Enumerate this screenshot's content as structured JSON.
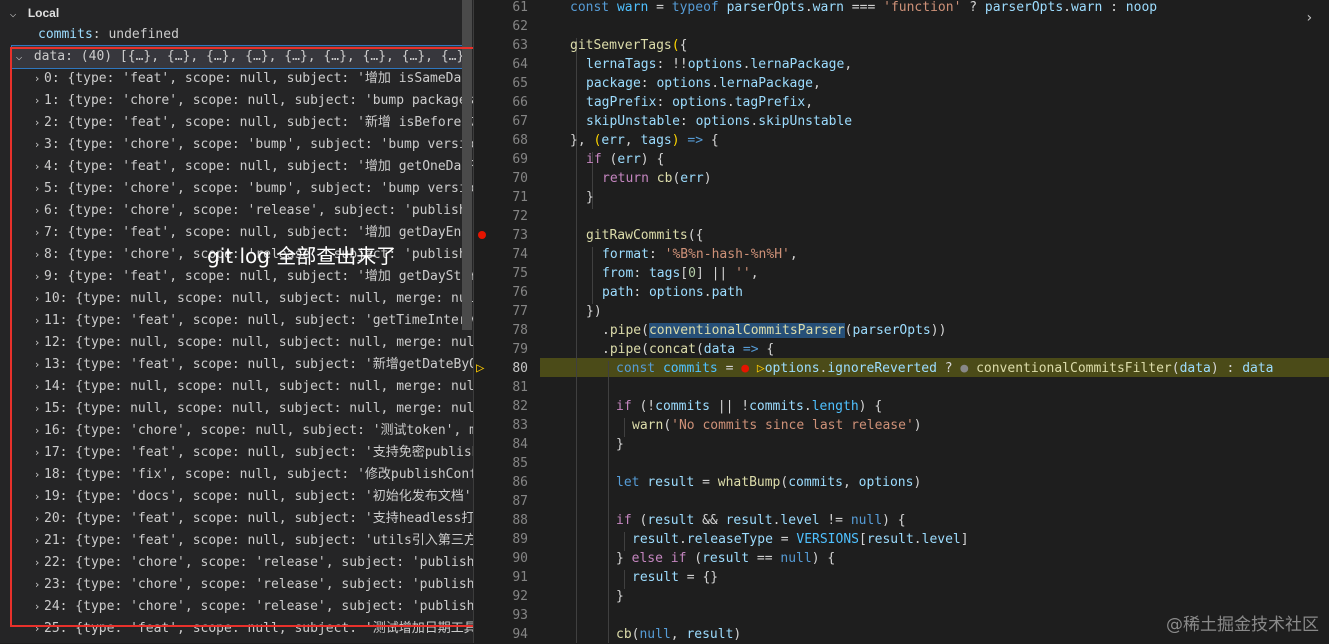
{
  "debug": {
    "section_title": "Local",
    "commits_var": {
      "name": "commits",
      "value": "undefined"
    },
    "data_var": {
      "label": "data: (40) [{…}, {…}, {…}, {…}, {…}, {…}, {…}, {…}, {…}, {…"
    },
    "items": [
      "0: {type: 'feat', scope: null, subject: '增加 isSameDay 方…",
      "1: {type: 'chore', scope: null, subject: 'bump packages ve…",
      "2: {type: 'feat', scope: null, subject: '新增 isBefore 方法…",
      "3: {type: 'chore', scope: 'bump', subject: 'bump version f…",
      "4: {type: 'feat', scope: null, subject: '增加 getOneDayRan…",
      "5: {type: 'chore', scope: 'bump', subject: 'bump version f…",
      "6: {type: 'chore', scope: 'release', subject: 'publish', m…",
      "7: {type: 'feat', scope: null, subject: '增加 getDayEnd 方…",
      "8: {type: 'chore', scope: 'release', subject: 'publish', m…",
      "9: {type: 'feat', scope: null, subject: '增加 getDayStart …",
      "10: {type: null, scope: null, subject: null, merge: null, …",
      "11: {type: 'feat', scope: null, subject: 'getTimeInterval'…",
      "12: {type: null, scope: null, subject: null, merge: null, …",
      "13: {type: 'feat', scope: null, subject: '新增getDateByOff…",
      "14: {type: null, scope: null, subject: null, merge: null, …",
      "15: {type: null, scope: null, subject: null, merge: null, …",
      "16: {type: 'chore', scope: null, subject: '测试token', mer…",
      "17: {type: 'feat', scope: null, subject: '支持免密publish',…",
      "18: {type: 'fix', scope: null, subject: '修改publishConfig…",
      "19: {type: 'docs', scope: null, subject: '初始化发布文档', …",
      "20: {type: 'feat', scope: null, subject: '支持headless打包'…",
      "21: {type: 'feat', scope: null, subject: 'utils引入第三方依…",
      "22: {type: 'chore', scope: 'release', subject: 'publish %s…",
      "23: {type: 'chore', scope: 'release', subject: 'publish %s…",
      "24: {type: 'chore', scope: 'release', subject: 'publish %s…",
      "25: {type: 'feat', scope: null, subject: '测试增加日期工具',…"
    ],
    "annotation": "git log 全部查出来了"
  },
  "editor": {
    "line_numbers": [
      "61",
      "62",
      "63",
      "64",
      "65",
      "66",
      "67",
      "68",
      "69",
      "70",
      "71",
      "72",
      "73",
      "74",
      "75",
      "76",
      "77",
      "78",
      "79",
      "80",
      "81",
      "82",
      "83",
      "84",
      "85",
      "86",
      "87",
      "88",
      "89",
      "90",
      "91",
      "92",
      "93",
      "94"
    ],
    "current_line": "80",
    "breakpoint_line": "73"
  },
  "watermark": "@稀土掘金技术社区",
  "colors": {
    "accent": "#e8312b",
    "highlight": "#4b4b18",
    "selection": "#37373d"
  }
}
